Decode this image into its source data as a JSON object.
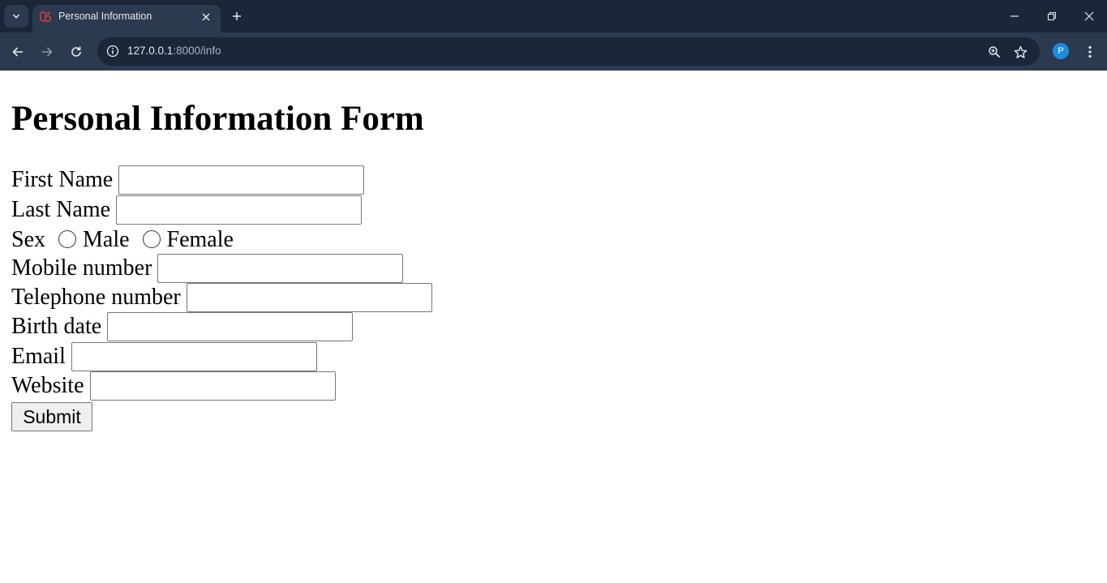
{
  "browser": {
    "tab_title": "Personal Information",
    "url_host": "127.0.0.1",
    "url_rest": ":8000/info",
    "profile_initial": "P",
    "icons": {
      "tab_search": "chevron-down-icon",
      "favicon": "laravel-icon",
      "tab_close": "close-icon",
      "new_tab": "plus-icon",
      "minimize": "minimize-icon",
      "restore": "restore-icon",
      "close_window": "close-icon",
      "back": "arrow-left-icon",
      "forward": "arrow-right-icon",
      "reload": "reload-icon",
      "site_info": "info-icon",
      "zoom": "zoom-icon",
      "bookmark": "star-icon",
      "menu": "kebab-menu-icon"
    },
    "colors": {
      "frame": "#1b2638",
      "toolbar": "#2c3a4f",
      "profile": "#1a8de0",
      "favicon": "#e0443c"
    }
  },
  "page": {
    "heading": "Personal Information Form",
    "form": {
      "first_name_label": "First Name",
      "first_name_value": "",
      "last_name_label": "Last Name",
      "last_name_value": "",
      "sex_label": "Sex",
      "sex_options": [
        "Male",
        "Female"
      ],
      "mobile_label": "Mobile number",
      "mobile_value": "",
      "telephone_label": "Telephone number",
      "telephone_value": "",
      "birth_date_label": "Birth date",
      "birth_date_value": "",
      "email_label": "Email",
      "email_value": "",
      "website_label": "Website",
      "website_value": "",
      "submit_label": "Submit"
    }
  }
}
